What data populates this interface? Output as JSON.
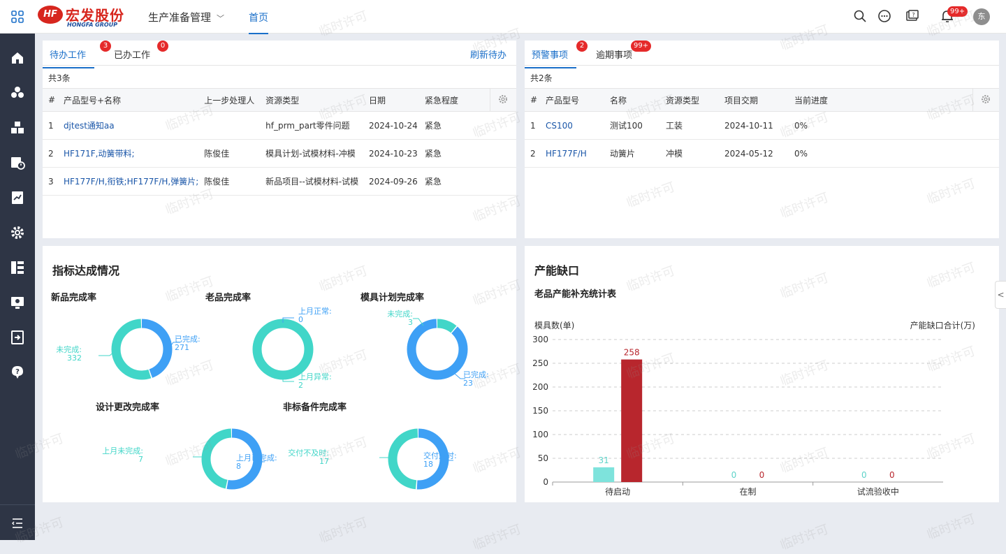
{
  "brand": {
    "cn": "宏发股份",
    "en": "HONGFA GROUP",
    "mark": "HF"
  },
  "header": {
    "module": "生产准备管理",
    "nav_home": "首页",
    "bell_badge": "99+",
    "avatar": "东"
  },
  "todo_panel": {
    "tabs": [
      {
        "label": "待办工作",
        "badge": "3"
      },
      {
        "label": "已办工作",
        "badge": "0"
      }
    ],
    "refresh": "刷新待办",
    "count": "共3条",
    "columns": [
      "#",
      "产品型号+名称",
      "上一步处理人",
      "资源类型",
      "日期",
      "紧急程度"
    ],
    "rows": [
      [
        "1",
        "djtest通知aa",
        "",
        "hf_prm_part零件问题",
        "2024-10-24",
        "紧急"
      ],
      [
        "2",
        "HF171F,动簧带料;",
        "陈俊佳",
        "模具计划-试模材料-冲模",
        "2024-10-23",
        "紧急"
      ],
      [
        "3",
        "HF177F/H,衔铁;HF177F/H,弹簧片;",
        "陈俊佳",
        "新品项目--试模材料-试模",
        "2024-09-26",
        "紧急"
      ]
    ]
  },
  "warn_panel": {
    "tabs": [
      {
        "label": "预警事项",
        "badge": "2"
      },
      {
        "label": "逾期事项",
        "badge": "99+"
      }
    ],
    "count": "共2条",
    "columns": [
      "#",
      "产品型号",
      "名称",
      "资源类型",
      "项目交期",
      "当前进度"
    ],
    "rows": [
      [
        "1",
        "CS100",
        "测试100",
        "工装",
        "2024-10-11",
        "0%"
      ],
      [
        "2",
        "HF177F/H",
        "动簧片",
        "冲模",
        "2024-05-12",
        "0%"
      ]
    ]
  },
  "kpi": {
    "title": "指标达成情况",
    "donuts": [
      {
        "title": "新品完成率",
        "a_label": "已完成:",
        "a_value": 271,
        "b_label": "未完成:",
        "b_value": 332
      },
      {
        "title": "老品完成率",
        "a_label": "上月正常:",
        "a_value": 0,
        "b_label": "上月异常:",
        "b_value": 2
      },
      {
        "title": "模具计划完成率",
        "a_label": "未完成:",
        "a_value": 3,
        "b_label": "已完成:",
        "b_value": 23
      },
      {
        "title": "设计更改完成率",
        "a_label": "上月已完成:",
        "a_value": 8,
        "b_label": "上月未完成:",
        "b_value": 7
      },
      {
        "title": "非标备件完成率",
        "a_label": "交付及时:",
        "a_value": 18,
        "b_label": "交付不及时:",
        "b_value": 17
      }
    ]
  },
  "capacity": {
    "title": "产能缺口",
    "subtitle": "老品产能补充统计表",
    "y_left_label": "模具数(单)",
    "y_right_label": "产能缺口合计(万)"
  },
  "chart_data": {
    "type": "bar",
    "title": "老品产能补充统计表",
    "categories": [
      "待启动",
      "在制",
      "试流验收中"
    ],
    "series": [
      {
        "values": [
          31,
          0,
          0
        ],
        "color": "#7ee3dc"
      },
      {
        "values": [
          258,
          0,
          0
        ],
        "color": "#b8262d"
      }
    ],
    "ylabel": "模具数(单)",
    "ylabel_right": "产能缺口合计(万)",
    "ylim": [
      0,
      300
    ],
    "yticks": [
      0,
      50,
      100,
      150,
      200,
      250,
      300
    ],
    "grid": true
  },
  "watermark": "临时许可",
  "colors": {
    "accent": "#1a6fc9",
    "badge": "#e52a2a",
    "sidebar": "#2e3545",
    "donut_blue": "#3ea0f5",
    "donut_teal": "#41d6c8"
  }
}
